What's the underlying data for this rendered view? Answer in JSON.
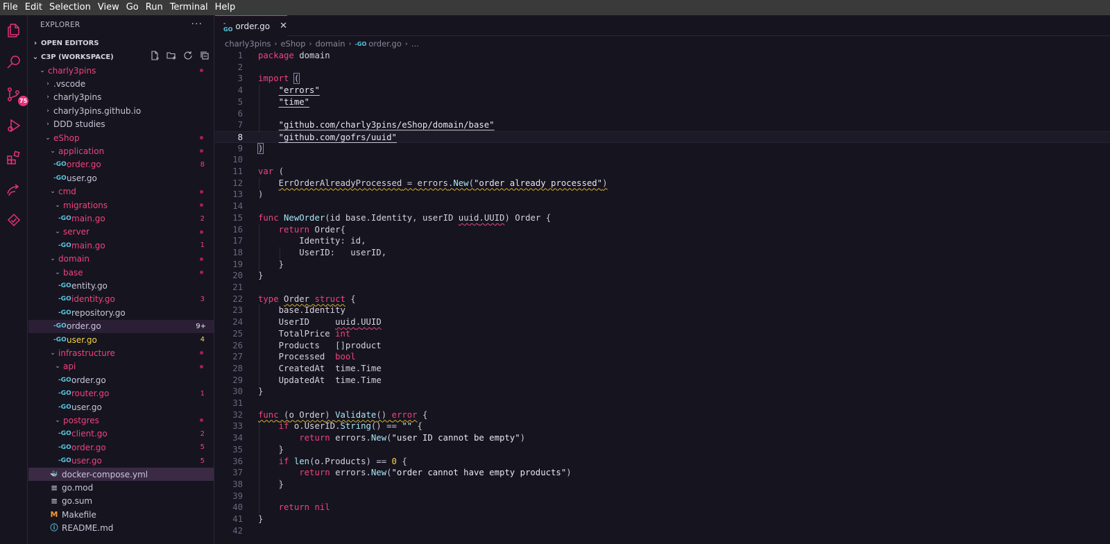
{
  "menu": [
    "File",
    "Edit",
    "Selection",
    "View",
    "Go",
    "Run",
    "Terminal",
    "Help"
  ],
  "activity": {
    "scm_badge": "75"
  },
  "sidebar": {
    "title": "EXPLORER",
    "more": "···",
    "open_editors": "OPEN EDITORS",
    "workspace": "C3P (WORKSPACE)",
    "tree": [
      {
        "name": "charly3pins",
        "type": "folder",
        "open": true,
        "level": 0,
        "state": "err",
        "deco": "dot"
      },
      {
        "name": ".vscode",
        "type": "folder",
        "open": false,
        "level": 1,
        "state": "",
        "deco": ""
      },
      {
        "name": "charly3pins",
        "type": "folder",
        "open": false,
        "level": 1,
        "state": "",
        "deco": ""
      },
      {
        "name": "charly3pins.github.io",
        "type": "folder",
        "open": false,
        "level": 1,
        "state": "",
        "deco": ""
      },
      {
        "name": "DDD studies",
        "type": "folder",
        "open": false,
        "level": 1,
        "state": "",
        "deco": ""
      },
      {
        "name": "eShop",
        "type": "folder",
        "open": true,
        "level": 1,
        "state": "err",
        "deco": "dot"
      },
      {
        "name": "application",
        "type": "folder",
        "open": true,
        "level": 2,
        "state": "err",
        "deco": "dot"
      },
      {
        "name": "order.go",
        "type": "go",
        "level": 3,
        "state": "err",
        "deco": "8"
      },
      {
        "name": "user.go",
        "type": "go",
        "level": 3,
        "state": "",
        "deco": ""
      },
      {
        "name": "cmd",
        "type": "folder",
        "open": true,
        "level": 2,
        "state": "err",
        "deco": "dot"
      },
      {
        "name": "migrations",
        "type": "folder",
        "open": true,
        "level": 3,
        "state": "err",
        "deco": "dot"
      },
      {
        "name": "main.go",
        "type": "go",
        "level": 4,
        "state": "err",
        "deco": "2"
      },
      {
        "name": "server",
        "type": "folder",
        "open": true,
        "level": 3,
        "state": "err",
        "deco": "dot"
      },
      {
        "name": "main.go",
        "type": "go",
        "level": 4,
        "state": "err",
        "deco": "1"
      },
      {
        "name": "domain",
        "type": "folder",
        "open": true,
        "level": 2,
        "state": "err",
        "deco": "dot"
      },
      {
        "name": "base",
        "type": "folder",
        "open": true,
        "level": 3,
        "state": "err",
        "deco": "dot"
      },
      {
        "name": "entity.go",
        "type": "go",
        "level": 4,
        "state": "",
        "deco": ""
      },
      {
        "name": "identity.go",
        "type": "go",
        "level": 4,
        "state": "err",
        "deco": "3"
      },
      {
        "name": "repository.go",
        "type": "go",
        "level": 4,
        "state": "",
        "deco": ""
      },
      {
        "name": "order.go",
        "type": "go",
        "level": 3,
        "state": "selected",
        "deco": "9+"
      },
      {
        "name": "user.go",
        "type": "go",
        "level": 3,
        "state": "warn",
        "deco": "4"
      },
      {
        "name": "infrastructure",
        "type": "folder",
        "open": true,
        "level": 2,
        "state": "err",
        "deco": "dot"
      },
      {
        "name": "api",
        "type": "folder",
        "open": true,
        "level": 3,
        "state": "err",
        "deco": "dot"
      },
      {
        "name": "order.go",
        "type": "go",
        "level": 4,
        "state": "",
        "deco": ""
      },
      {
        "name": "router.go",
        "type": "go",
        "level": 4,
        "state": "err",
        "deco": "1"
      },
      {
        "name": "user.go",
        "type": "go",
        "level": 4,
        "state": "",
        "deco": ""
      },
      {
        "name": "postgres",
        "type": "folder",
        "open": true,
        "level": 3,
        "state": "err",
        "deco": "dot"
      },
      {
        "name": "client.go",
        "type": "go",
        "level": 4,
        "state": "err",
        "deco": "2"
      },
      {
        "name": "order.go",
        "type": "go",
        "level": 4,
        "state": "err",
        "deco": "5"
      },
      {
        "name": "user.go",
        "type": "go",
        "level": 4,
        "state": "err",
        "deco": "5"
      },
      {
        "name": "docker-compose.yml",
        "type": "docker",
        "level": 2,
        "state": "active",
        "deco": ""
      },
      {
        "name": "go.mod",
        "type": "text",
        "level": 2,
        "state": "",
        "deco": ""
      },
      {
        "name": "go.sum",
        "type": "text",
        "level": 2,
        "state": "",
        "deco": ""
      },
      {
        "name": "Makefile",
        "type": "make",
        "level": 2,
        "state": "",
        "deco": ""
      },
      {
        "name": "README.md",
        "type": "info",
        "level": 2,
        "state": "",
        "deco": ""
      }
    ]
  },
  "tab": {
    "label": "order.go",
    "close": "✕"
  },
  "breadcrumb": [
    "charly3pins",
    "eShop",
    "domain",
    "order.go",
    "..."
  ],
  "editor": {
    "current_line": 8,
    "lines": [
      "package domain",
      "",
      "import (",
      "    \"errors\"",
      "    \"time\"",
      "",
      "    \"github.com/charly3pins/eShop/domain/base\"",
      "    \"github.com/gofrs/uuid\"",
      ")",
      "",
      "var (",
      "    ErrOrderAlreadyProcessed = errors.New(\"order already processed\")",
      ")",
      "",
      "func NewOrder(id base.Identity, userID uuid.UUID) Order {",
      "    return Order{",
      "        Identity: id,",
      "        UserID:   userID,",
      "    }",
      "}",
      "",
      "type Order struct {",
      "    base.Identity",
      "    UserID     uuid.UUID",
      "    TotalPrice int",
      "    Products   []product",
      "    Processed  bool",
      "    CreatedAt  time.Time",
      "    UpdatedAt  time.Time",
      "}",
      "",
      "func (o Order) Validate() error {",
      "    if o.UserID.String() == \"\" {",
      "        return errors.New(\"user ID cannot be empty\")",
      "    }",
      "    if len(o.Products) == 0 {",
      "        return errors.New(\"order cannot have empty products\")",
      "    }",
      "",
      "    return nil",
      "}",
      ""
    ]
  },
  "colors": {
    "accent": "#e9307b",
    "error": "#f0437e",
    "warning": "#f5d547",
    "background": "#16141f"
  }
}
